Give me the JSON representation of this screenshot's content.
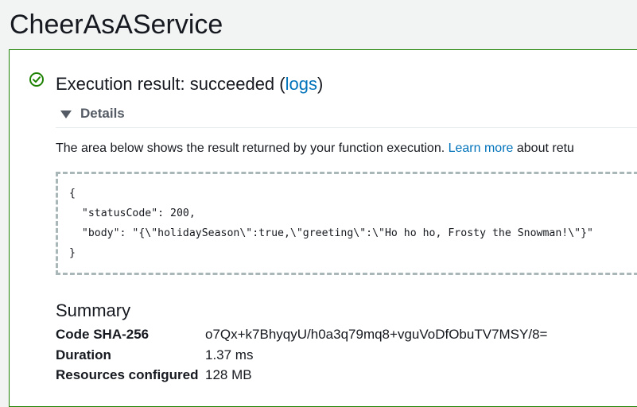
{
  "page": {
    "title": "CheerAsAService"
  },
  "result": {
    "heading_prefix": "Execution result: succeeded (",
    "logs_link": "logs",
    "heading_suffix": ")",
    "status_color": "#1d8102",
    "status_icon": "check-circle-icon"
  },
  "details": {
    "toggle_label": "Details",
    "description_prefix": "The area below shows the result returned by your function execution. ",
    "learn_more_link": "Learn more",
    "description_suffix": " about retu",
    "code_lines": [
      "{",
      "  \"statusCode\": 200,",
      "  \"body\": \"{\\\"holidaySeason\\\":true,\\\"greeting\\\":\\\"Ho ho ho, Frosty the Snowman!\\\"}\"",
      "}"
    ]
  },
  "summary": {
    "title": "Summary",
    "rows": [
      {
        "key": "Code SHA-256",
        "value": "o7Qx+k7BhyqyU/h0a3q79mq8+vguVoDfObuTV7MSY/8="
      },
      {
        "key": "Duration",
        "value": "1.37 ms"
      },
      {
        "key": "Resources configured",
        "value": "128 MB"
      }
    ]
  },
  "colors": {
    "link": "#0073bb",
    "success": "#1d8102",
    "background": "#f2f3f3"
  }
}
